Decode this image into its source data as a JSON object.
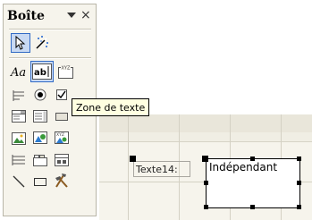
{
  "toolbox": {
    "title": "Boîte",
    "close_glyph": "×",
    "tools": [
      {
        "name": "pointer-select-icon",
        "selected": true
      },
      {
        "name": "control-wizards-icon",
        "selected": false
      },
      {
        "name": "label-icon",
        "selected": false
      },
      {
        "name": "text-box-icon",
        "selected": true
      },
      {
        "name": "option-group-icon",
        "selected": false
      },
      {
        "name": "toggle-button-icon",
        "selected": false
      },
      {
        "name": "option-button-icon",
        "selected": false
      },
      {
        "name": "check-box-icon",
        "selected": false
      },
      {
        "name": "combo-box-icon",
        "selected": false
      },
      {
        "name": "list-box-icon",
        "selected": false
      },
      {
        "name": "command-button-icon",
        "selected": false
      },
      {
        "name": "image-icon",
        "selected": false
      },
      {
        "name": "unbound-object-frame-icon",
        "selected": false
      },
      {
        "name": "bound-object-frame-icon",
        "selected": false
      },
      {
        "name": "page-break-icon",
        "selected": false
      },
      {
        "name": "tab-control-icon",
        "selected": false
      },
      {
        "name": "subform-icon",
        "selected": false
      },
      {
        "name": "line-icon",
        "selected": false
      },
      {
        "name": "rectangle-icon",
        "selected": false
      },
      {
        "name": "more-controls-icon",
        "selected": false
      }
    ]
  },
  "tooltip": {
    "text": "Zone de texte"
  },
  "design": {
    "label_text": "Texte14:",
    "textbox_value": "Indépendant"
  },
  "colors": {
    "selection_fill": "#c8d9f3",
    "selection_border": "#316ac5",
    "tooltip_bg": "#ffffe1"
  }
}
